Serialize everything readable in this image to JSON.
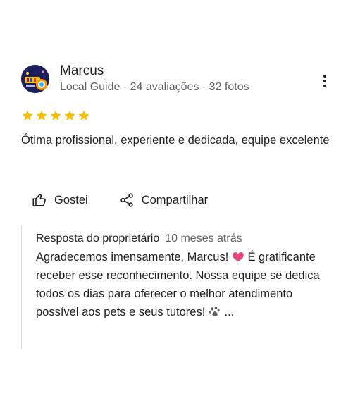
{
  "review": {
    "author": {
      "name": "Marcus",
      "meta": "Local Guide · 24 avaliações · 32 fotos"
    },
    "rating": 5,
    "text": "Ótima profissional, experiente e dedicada, equipe excelente"
  },
  "actions": {
    "like_label": "Gostei",
    "share_label": "Compartilhar"
  },
  "reply": {
    "title": "Resposta do proprietário",
    "time": "10 meses atrás",
    "text_part1": "Agradecemos imensamente, Marcus!",
    "text_part2": "É gratificante receber esse reconhecimento. Nossa equipe se dedica todos os dias para oferecer o melhor atendimento possível aos pets e seus tutores!",
    "text_ellipsis": "..."
  },
  "colors": {
    "star": "#fbbc04",
    "heart": "#e8437a",
    "meta_text": "#5f6368",
    "avatar_bg": "#1b1f5c"
  },
  "icons": {
    "more": "more-vert-icon",
    "like": "thumb-up-icon",
    "share": "share-icon",
    "heart": "heart-icon",
    "paw": "paw-icon"
  }
}
